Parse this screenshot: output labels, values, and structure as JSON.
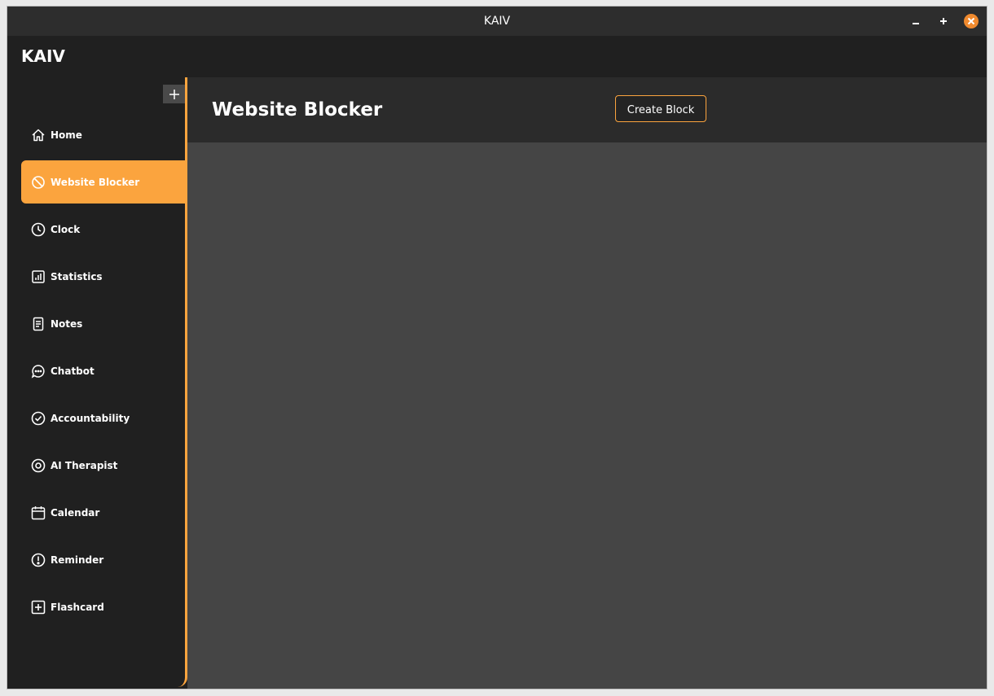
{
  "window": {
    "title": "KAIV",
    "controls": [
      "minimize-icon",
      "maximize-icon",
      "close-icon"
    ]
  },
  "header": {
    "brand": "KAIV"
  },
  "sidebar": {
    "add_icon": "plus-icon",
    "items": [
      {
        "label": "Home",
        "icon": "home-icon",
        "active": false
      },
      {
        "label": "Website Blocker",
        "icon": "block-icon",
        "active": true
      },
      {
        "label": "Clock",
        "icon": "clock-icon",
        "active": false
      },
      {
        "label": "Statistics",
        "icon": "bar-chart-icon",
        "active": false
      },
      {
        "label": "Notes",
        "icon": "note-icon",
        "active": false
      },
      {
        "label": "Chatbot",
        "icon": "chat-bubble-icon",
        "active": false
      },
      {
        "label": "Accountability",
        "icon": "check-circle-icon",
        "active": false
      },
      {
        "label": "AI Therapist",
        "icon": "target-icon",
        "active": false
      },
      {
        "label": "Calendar",
        "icon": "calendar-icon",
        "active": false
      },
      {
        "label": "Reminder",
        "icon": "alert-circle-icon",
        "active": false
      },
      {
        "label": "Flashcard",
        "icon": "plus-square-icon",
        "active": false
      }
    ]
  },
  "main": {
    "title": "Website Blocker",
    "create_button": "Create Block"
  },
  "colors": {
    "accent": "#fba43e",
    "sidebar_bg": "#202020",
    "header_bg": "#2b2b2b",
    "content_bg": "#454545",
    "close_button": "#f08a2e"
  }
}
